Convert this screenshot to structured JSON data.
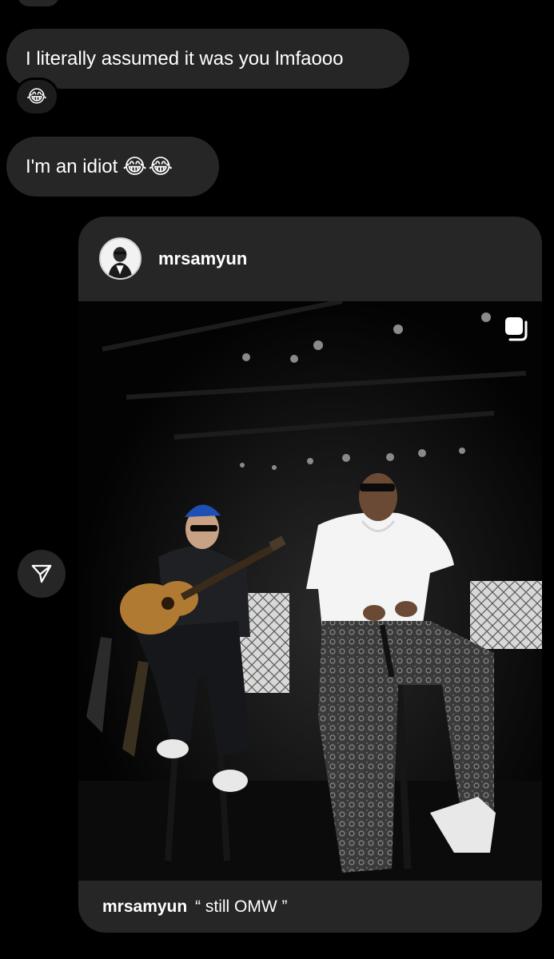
{
  "messages": [
    {
      "text": "I literally assumed it was you lmfaooo",
      "reaction": "😂"
    },
    {
      "text": "I'm an idiot",
      "emoji": "😂😂"
    }
  ],
  "shared_post": {
    "username": "mrsamyun",
    "caption_user": "mrsamyun",
    "caption_text": "“ still OMW ”",
    "media_icon": "carousel-icon"
  },
  "actions": {
    "share_icon": "paper-plane-icon"
  },
  "colors": {
    "background": "#000000",
    "bubble": "#262626"
  }
}
